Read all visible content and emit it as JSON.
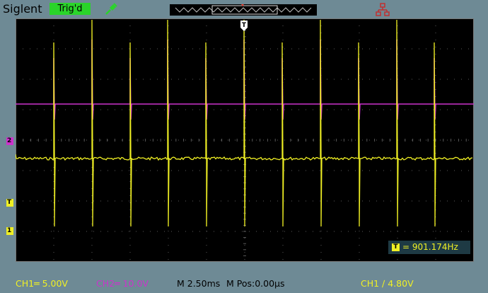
{
  "header": {
    "brand": "Siglent",
    "trigger_status": "Trig'd",
    "trigger_marker": "T"
  },
  "channels": {
    "ch1": {
      "marker": "1",
      "color": "#f0f024"
    },
    "ch2": {
      "marker": "2",
      "color": "#cc33cc"
    },
    "trigger": {
      "marker": "T"
    }
  },
  "measurement": {
    "marker": "T",
    "frequency": "= 901.174Hz"
  },
  "footer": {
    "ch1_scale": "CH1═ 5.00V",
    "ch2_scale": "CH2═ 10.0V",
    "time_scale": "M 2.50ms",
    "time_position": "M Pos:0.00µs",
    "trigger_info": "CH1 ∕ 4.80V"
  },
  "colors": {
    "background": "#6e8a95",
    "screen": "#000000",
    "grid": "#5a5a5a",
    "ch1": "#f0f024",
    "ch2": "#cc33cc",
    "status_green": "#2ad42a"
  },
  "icons": {
    "probe": "probe-icon",
    "network": "network-icon"
  }
}
